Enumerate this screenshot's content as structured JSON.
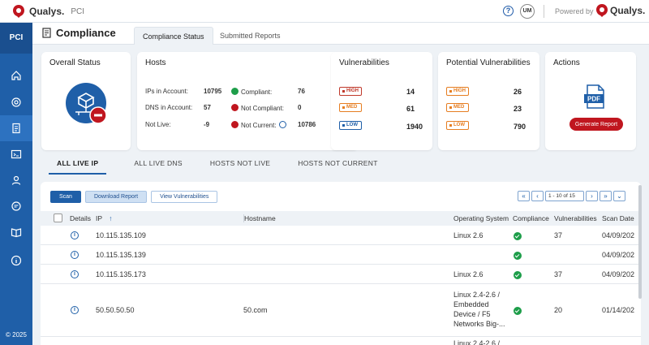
{
  "header": {
    "brand": "Qualys.",
    "product": "PCI",
    "help": "?",
    "avatar": "UM",
    "powered_by": "Powered by",
    "powered_brand": "Qualys."
  },
  "sidebar": {
    "section": "PCI",
    "copyright": "© 2025",
    "items": [
      "home",
      "dashboard",
      "compliance",
      "reports",
      "users",
      "support",
      "docs",
      "info"
    ]
  },
  "page": {
    "title": "Compliance",
    "tabs": [
      "Compliance Status",
      "Submitted Reports"
    ]
  },
  "overall": {
    "title": "Overall Status"
  },
  "hosts": {
    "title": "Hosts",
    "ips_label": "IPs in Account:",
    "ips_value": "10795",
    "dns_label": "DNS in Account:",
    "dns_value": "57",
    "notlive_label": "Not Live:",
    "notlive_value": "-9",
    "compliant_label": "Compliant:",
    "compliant_value": "76",
    "notcompliant_label": "Not Compliant:",
    "notcompliant_value": "0",
    "notcurrent_label": "Not Current:",
    "notcurrent_value": "10786"
  },
  "vulns": {
    "title": "Vulnerabilities",
    "high": "14",
    "med": "61",
    "low": "1940"
  },
  "potential": {
    "title": "Potential Vulnerabilities",
    "high": "26",
    "med": "23",
    "low": "790"
  },
  "severity": {
    "high": "HIGH",
    "med": "MED",
    "low": "LOW"
  },
  "actions": {
    "title": "Actions",
    "pdf": "PDF",
    "generate": "Generate Report"
  },
  "subtabs": [
    "ALL LIVE IP",
    "ALL LIVE DNS",
    "HOSTS NOT LIVE",
    "HOSTS NOT CURRENT"
  ],
  "toolbar": {
    "scan": "Scan",
    "download": "Download Report",
    "view": "View Vulnerabilities"
  },
  "pager": {
    "info": "1 - 10 of 15"
  },
  "columns": {
    "details": "Details",
    "ip": "IP",
    "hostname": "Hostname",
    "os": "Operating System",
    "compliance": "Compliance",
    "vulns": "Vulnerabilities",
    "scan_date": "Scan Date"
  },
  "rows": [
    {
      "ip": "10.115.135.109",
      "hostname": "",
      "os": "Linux 2.6",
      "vulns": "37",
      "date": "04/09/202"
    },
    {
      "ip": "10.115.135.139",
      "hostname": "",
      "os": "",
      "vulns": "",
      "date": "04/09/202"
    },
    {
      "ip": "10.115.135.173",
      "hostname": "",
      "os": "Linux 2.6",
      "vulns": "37",
      "date": "04/09/202"
    },
    {
      "ip": "50.50.50.50",
      "hostname": "50.com",
      "os": "Linux 2.4-2.6 /\nEmbedded\nDevice / F5\nNetworks Big-...",
      "vulns": "20",
      "date": "01/14/202"
    },
    {
      "ip": "",
      "hostname": "",
      "os": "Linux 2.4-2.6 /",
      "vulns": "",
      "date": ""
    }
  ],
  "colors": {
    "sidebar": "#1f5fa8",
    "accent": "#1f5fa8",
    "danger": "#c0161f",
    "success": "#1e9e4a"
  }
}
